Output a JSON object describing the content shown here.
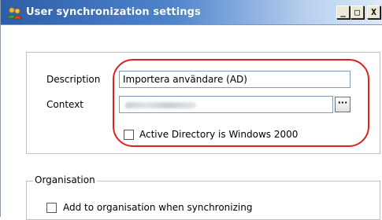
{
  "window": {
    "title": "User synchronization settings",
    "controls": {
      "minimize": "_",
      "maximize": "□",
      "close": "X"
    }
  },
  "group_main": {
    "description_label": "Description",
    "description_value": "Importera användare (AD)",
    "context_label": "Context",
    "context_value": "",
    "browse_label": "···",
    "ad_checkbox_label": "Active Directory is Windows 2000",
    "ad_checkbox_checked": false
  },
  "group_organisation": {
    "title": "Organisation",
    "add_checkbox_label": "Add to organisation when synchronizing",
    "add_checkbox_checked": false
  },
  "colors": {
    "titlebar_start": "#2d5ea8",
    "titlebar_end": "#dce9f8",
    "highlight": "#e0201e"
  }
}
